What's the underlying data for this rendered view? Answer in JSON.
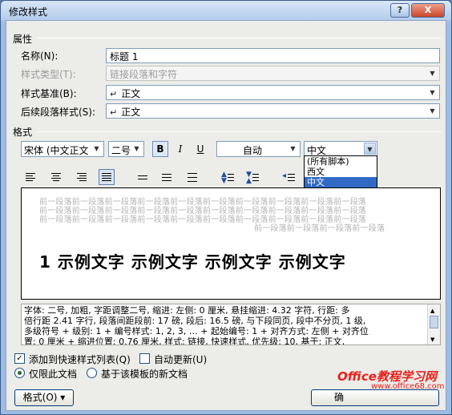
{
  "window": {
    "title": "修改样式",
    "help_label": "?",
    "close_label": "X"
  },
  "properties": {
    "section_label": "属性",
    "name_label": "名称(N):",
    "name_value": "标题 1",
    "type_label": "样式类型(T):",
    "type_value": "链接段落和字符",
    "based_on_label": "样式基准(B):",
    "based_on_value": "正文",
    "following_label": "后续段落样式(S):",
    "following_value": "正文",
    "para_glyph": "↵"
  },
  "format": {
    "section_label": "格式",
    "font_value": "宋体 (中文正文",
    "size_value": "二号",
    "bold_label": "B",
    "italic_label": "I",
    "underline_label": "U",
    "color_value": "自动",
    "script_value": "中文",
    "script_options": [
      "(所有脚本)",
      "西文",
      "中文"
    ],
    "script_selected": "中文"
  },
  "preview": {
    "prev_lines": [
      "前一段落前一段落前一段落前一段落前一段落前一段落前一段落前一段落前一段落前一段落",
      "前一段落前一段落前一段落前一段落前一段落前一段落前一段落前一段落前一段落前一段落",
      "前一段落前一段落前一段落前一段落前一段落前一段落前一段落前一段落前一段落前一段落",
      "前一段落前一段落前一段落前一段落"
    ],
    "sample_text": "1 示例文字 示例文字 示例文字 示例文字"
  },
  "description": [
    "字体: 二号, 加粗, 字距调整二号, 缩进: 左侧: 0 厘米, 悬挂缩进: 4.32 字符, 行距: 多",
    "倍行距 2.41 字行, 段落间距段前: 17 磅, 段后: 16.5 磅, 与下段同页, 段中不分页, 1 级,",
    "多级符号 + 级别: 1 + 编号样式: 1, 2, 3, … + 起始编号: 1 + 对齐方式: 左侧 + 对齐位",
    "置: 0 厘米 + 缩进位置: 0.76 厘米, 样式: 链接, 快速样式, 优先级: 10, 基于: 正文,"
  ],
  "options": {
    "quick_style_label": "添加到快速样式列表(Q)",
    "quick_style_checked": true,
    "auto_update_label": "自动更新(U)",
    "auto_update_checked": false,
    "this_doc_label": "仅限此文档",
    "template_label": "基于该模板的新文档"
  },
  "buttons": {
    "format_label": "格式(O) ▾",
    "ok_label": "确"
  },
  "watermark": {
    "text": "Office教程学习网",
    "url": "www.office68.com"
  }
}
